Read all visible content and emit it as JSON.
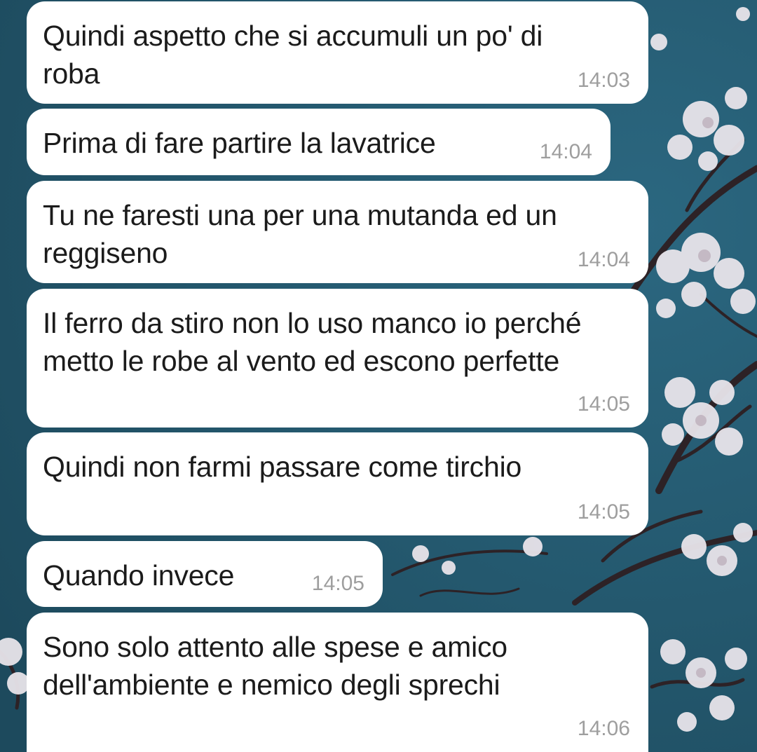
{
  "theme": {
    "bubble_color": "#ffffff",
    "text_color": "#1b1b1b",
    "time_color": "#9e9e9e",
    "wallpaper_sky": "#23566b",
    "wallpaper_blossom": "#e8e4ea",
    "wallpaper_branch": "#2d2226"
  },
  "messages": [
    {
      "text": "Quindi aspetto che si accumuli un po' di\nroba",
      "time": "14:03"
    },
    {
      "text": "Prima di fare partire la lavatrice",
      "time": "14:04"
    },
    {
      "text": "Tu ne faresti una per una mutanda ed un\nreggiseno",
      "time": "14:04"
    },
    {
      "text": "Il ferro da stiro non lo uso manco io perché\nmetto le robe al vento ed escono perfette",
      "time": "14:05"
    },
    {
      "text": "Quindi non farmi passare come tirchio",
      "time": "14:05"
    },
    {
      "text": "Quando invece",
      "time": "14:05"
    },
    {
      "text": "Sono solo attento alle spese e amico\ndell'ambiente e nemico degli sprechi",
      "time": "14:06"
    }
  ]
}
